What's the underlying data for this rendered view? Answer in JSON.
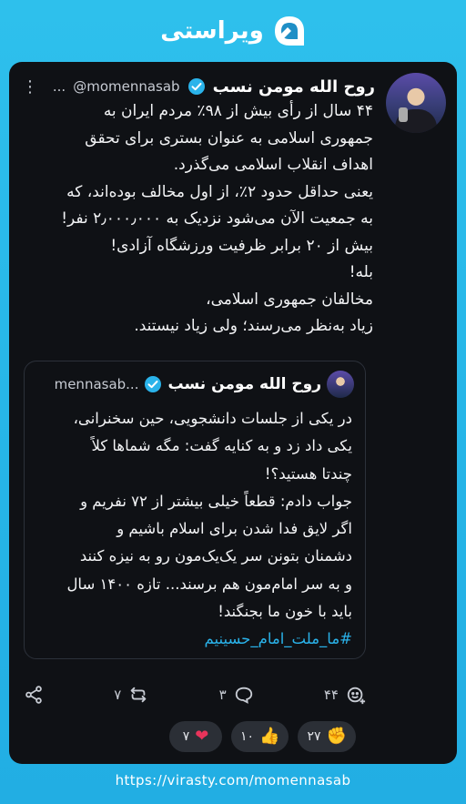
{
  "brand": {
    "name": "ویراستی"
  },
  "tweet": {
    "author": "روح الله مومن نسب",
    "handle": "@momennasab",
    "more": "...",
    "lines": [
      "۴۴ سال از رأی بیش از ۹۸٪ مردم ایران به",
      "جمهوری اسلامی به عنوان بستری برای تحقق",
      "اهداف انقلاب اسلامی می‌گذرد.",
      "یعنی حداقل حدود ۲٪، از اول مخالف بوده‌اند، که",
      "به جمعیت الآن می‌شود نزدیک به ۲٫۰۰۰٫۰۰۰ نفر!",
      "بیش از ۲۰ برابر ظرفیت ورزشگاه آزادی!",
      "بله!",
      "مخالفان جمهوری اسلامی،",
      "زیاد به‌نظر می‌رسند؛ ولی زیاد نیستند."
    ]
  },
  "quote": {
    "author": "روح الله مومن نسب",
    "handle": "mennasab...",
    "lines": [
      "در یکی از جلسات دانشجویی، حین سخنرانی،",
      "یکی داد زد و به کنایه گفت: مگه شماها کلاً",
      "چندتا هستید؟!",
      "جواب دادم: قطعاً خیلی بیشتر از ۷۲ نفریم و",
      "اگر لایق فدا شدن برای اسلام باشیم و",
      "دشمنان بتونن سر یک‌یک‌مون رو به نیزه کنند",
      "و به سر امام‌مون هم برسند... تازه ۱۴۰۰ سال",
      "باید با خون ما بجنگند!"
    ],
    "hashtag": "#ما_ملت_امام_حسینیم"
  },
  "actions": {
    "likes": "۴۴",
    "comments": "۳",
    "reposts": "۷"
  },
  "reactions": [
    {
      "icon": "heart-icon",
      "emoji": "❤",
      "count": "۷"
    },
    {
      "icon": "thumbs-up-icon",
      "emoji": "👍",
      "count": "۱۰"
    },
    {
      "icon": "fist-icon",
      "emoji": "✊",
      "count": "۲۷"
    }
  ],
  "footer": {
    "url": "https://virasty.com/momennasab"
  },
  "colors": {
    "accent": "#2ab3ea",
    "background": "#0f1115",
    "frame": "#27b6e8"
  }
}
